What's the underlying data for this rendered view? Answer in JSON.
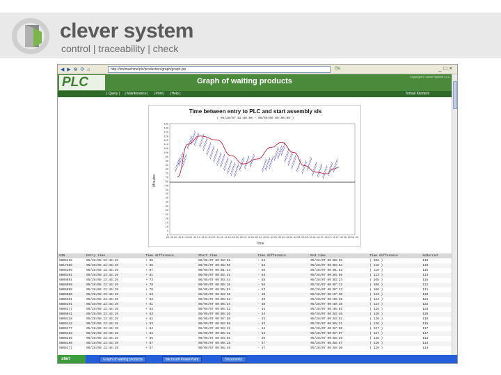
{
  "brand": {
    "name": "clever system",
    "tagline": "control | traceability | check"
  },
  "browser": {
    "url": "http://testmachine/plc/production/graph/graph.jsp",
    "go_label": "Go",
    "nav_glyphs": "◀ ▶ ⊗ ⟳ ⌂"
  },
  "app": {
    "logo": "PLC",
    "title": "Graph of waiting products",
    "copyright": "Copyright © Clever System s.r.o.",
    "menu": [
      "| Query |",
      "| Maintenance |",
      "| Print |",
      "| Help |"
    ],
    "user": "Tomáš Klement"
  },
  "chart_data": {
    "type": "scatter",
    "title": "Time between entry to PLC and start assembly sls",
    "subtitle": "( 05/28/07 02:00:00 – 06/05/08 09:00:00 )",
    "xlabel": "Time",
    "ylabel": "Minutes",
    "ylim": [
      0,
      135
    ],
    "yticks": [
      0,
      5,
      10,
      15,
      20,
      25,
      30,
      35,
      40,
      45,
      50,
      55,
      60,
      65,
      70,
      75,
      80,
      85,
      90,
      95,
      100,
      105,
      110,
      115,
      120,
      125,
      130,
      135
    ],
    "xticks": [
      "00:20",
      "00:40",
      "01:00",
      "01:20",
      "01:40",
      "02:00",
      "02:20",
      "02:40",
      "03:00",
      "03:20",
      "03:40",
      "04:00",
      "04:20",
      "04:40",
      "05:00",
      "05:20",
      "05:40",
      "06:00",
      "06:20",
      "06:40",
      "07:00",
      "07:20",
      "07:40",
      "08:00",
      "08:20"
    ],
    "reference_line": 64,
    "trend": [
      [
        0.2,
        70
      ],
      [
        0.8,
        110
      ],
      [
        1.5,
        120
      ],
      [
        2.5,
        115
      ],
      [
        3.3,
        96
      ],
      [
        4.0,
        86
      ],
      [
        4.8,
        92
      ],
      [
        5.6,
        106
      ],
      [
        6.2,
        112
      ],
      [
        6.9,
        100
      ],
      [
        7.5,
        84
      ],
      [
        8.2,
        76
      ],
      [
        8.8,
        74
      ],
      [
        9.2,
        80
      ],
      [
        9.5,
        82
      ]
    ],
    "series_points": [
      [
        0.2,
        85
      ],
      [
        0.4,
        92
      ],
      [
        0.6,
        90
      ],
      [
        0.9,
        112
      ],
      [
        1.1,
        118
      ],
      [
        1.3,
        116
      ],
      [
        1.6,
        114
      ],
      [
        1.8,
        110
      ],
      [
        2.0,
        104
      ],
      [
        2.2,
        100
      ],
      [
        2.4,
        96
      ],
      [
        2.6,
        92
      ],
      [
        2.8,
        90
      ],
      [
        3.0,
        86
      ],
      [
        3.2,
        82
      ],
      [
        3.4,
        80
      ],
      [
        3.6,
        78
      ],
      [
        3.9,
        86
      ],
      [
        4.2,
        88
      ],
      [
        4.5,
        90
      ],
      [
        5.2,
        84
      ],
      [
        5.4,
        86
      ],
      [
        5.6,
        88
      ],
      [
        5.9,
        98
      ],
      [
        6.1,
        100
      ],
      [
        6.3,
        104
      ],
      [
        6.5,
        96
      ],
      [
        6.7,
        92
      ],
      [
        6.9,
        88
      ],
      [
        7.2,
        84
      ],
      [
        7.5,
        82
      ],
      [
        7.8,
        86
      ],
      [
        8.1,
        80
      ],
      [
        8.4,
        78
      ],
      [
        8.7,
        76
      ],
      [
        9.0,
        80
      ],
      [
        9.3,
        84
      ]
    ]
  },
  "table": {
    "headers": [
      "VIN",
      "Entry time",
      "Time difference",
      "Start time",
      "Time difference",
      "End time",
      "Time difference",
      "Sdderred"
    ],
    "rows": [
      [
        "5806425",
        "05/28/08 22:44:19",
        "+ 85",
        "06/05/07 00:02:58",
        "- 53",
        "05/28/07 00:08:55",
        "( 106 )",
        "115"
      ],
      [
        "5817358",
        "05/28/08 22:44:19",
        "+ 65",
        "06/05/07 00:02:56",
        "- 53",
        "05/28/07 00:04:54",
        "( 116 )",
        "110"
      ],
      [
        "5806105",
        "05/28/08 22:44:19",
        "+ 87",
        "06/05/07 00:01:34",
        "- 58",
        "05/28/07 00:01:53",
        "( 110 )",
        "115"
      ],
      [
        "5806101",
        "05/28/08 22:44:19",
        "+ 81",
        "06/05/07 00:02:31",
        "- 53",
        "05/28/07 00:03:56",
        "( 113 )",
        "114"
      ],
      [
        "5806091",
        "05/28/08 22:44:19",
        "+ 73",
        "06/05/07 00:03:44",
        "- 58",
        "05/28/07 00:03:24",
        "( 105 )",
        "115"
      ],
      [
        "5806098",
        "05/28/08 22:44:19",
        "+ 78",
        "06/05/07 00:05:16",
        "- 58",
        "05/28/07 00:07:12",
        "( 106 )",
        "112"
      ],
      [
        "5806099",
        "05/28/08 22:44:19",
        "+ 78",
        "06/05/07 00:05:53",
        "- 53",
        "05/28/07 00:07:17",
        "( 106 )",
        "111"
      ],
      [
        "5806088",
        "05/28/08 22:44:19",
        "+ 63",
        "06/05/07 00:04:18",
        "- 48",
        "05/28/07 00:47:30",
        "( 123 )",
        "110"
      ],
      [
        "5806101",
        "05/28/08 22:44:19",
        "+ 63",
        "06/05/07 00:05:53",
        "- 48",
        "05/28/07 00:48:38",
        "( 124 )",
        "121"
      ],
      [
        "5806101",
        "05/28/08 22:44:19",
        "+ 61",
        "06/05/07 00:05:34",
        "- 48",
        "05/28/07 00:49:39",
        "( 124 )",
        "122"
      ],
      [
        "5806177",
        "05/28/08 22:44:19",
        "+ 63",
        "06/05/07 00:05:31",
        "- 44",
        "05/28/07 00:46:01",
        "( 125 )",
        "123"
      ],
      [
        "5806041",
        "05/28/08 22:44:19",
        "+ 63",
        "06/05/07 00:05:36",
        "- 44",
        "05/28/07 00:53:46",
        "( 126 )",
        "126"
      ],
      [
        "5806138",
        "05/28/08 22:44:19",
        "+ 62",
        "06/05/07 00:07:30",
        "- 43",
        "05/28/07 00:53:52",
        "( 126 )",
        "116"
      ],
      [
        "5806142",
        "05/28/08 22:44:19",
        "+ 63",
        "06/05/07 00:04:58",
        "- 43",
        "05/28/07 00:55:21",
        "( 126 )",
        "115"
      ],
      [
        "5806177",
        "05/28/08 22:44:19",
        "+ 64",
        "06/05/07 00:04:41",
        "- 44",
        "05/28/07 00:57:09",
        "( 127 )",
        "117"
      ],
      [
        "5806168",
        "05/28/08 22:44:19",
        "+ 64",
        "06/05/07 00:05:12",
        "- 44",
        "05/28/07 00:57:07",
        "( 127 )",
        "117"
      ],
      [
        "5806256",
        "05/28/08 22:44:19",
        "+ 65",
        "06/05/07 00:04:56",
        "- 48",
        "05/28/07 00:58:29",
        "( 128 )",
        "113"
      ],
      [
        "5806198",
        "05/28/08 22:44:19",
        "+ 67",
        "06/05/07 00:06:18",
        "- 47",
        "05/28/07 00:58:57",
        "( 128 )",
        "114"
      ],
      [
        "5806177",
        "05/28/08 22:44:19",
        "+ 67",
        "06/05/07 00:06:49",
        "- 47",
        "05/28/07 00:59:30",
        "( 129 )",
        "114"
      ]
    ]
  },
  "taskbar": {
    "start": "start",
    "tasks": [
      "Graph of waiting products",
      "Microsoft PowerPoint",
      "Document1"
    ]
  },
  "colors": {
    "plc_green": "#4a8a3a",
    "menu_green": "#2f6a2a",
    "points": "#2b2bb0",
    "trend": "#c0203a"
  }
}
